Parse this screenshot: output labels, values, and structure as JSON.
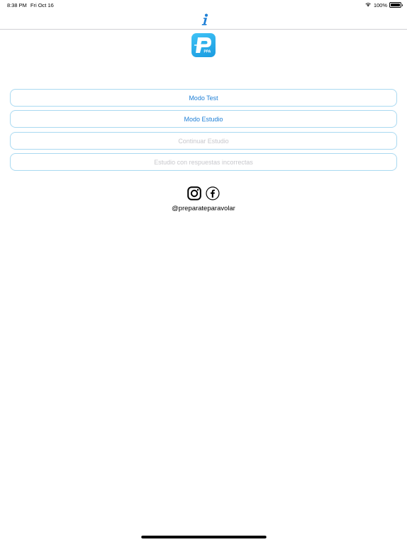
{
  "status_bar": {
    "time": "8:38 PM",
    "date": "Fri Oct 16",
    "battery_percent": "100%",
    "battery_level": 1.0,
    "wifi_icon": "wifi-icon",
    "battery_icon": "battery-icon"
  },
  "nav": {
    "info_icon": "info-icon",
    "info_color": "#1e7fd6"
  },
  "logo": {
    "text": "PPA",
    "color": "#29b1ee"
  },
  "menu": {
    "modo_test": "Modo Test",
    "modo_estudio": "Modo Estudio",
    "continuar_estudio": "Continuar Estudio",
    "respuestas_incorrectas": "Estudio con respuestas incorrectas",
    "enabled_color": "#1e7fd6",
    "disabled_color": "#c7c7cc",
    "border_color": "#a9d9f1"
  },
  "social": {
    "instagram_icon": "instagram-icon",
    "facebook_icon": "facebook-icon",
    "handle": "@preparateparavolar"
  }
}
